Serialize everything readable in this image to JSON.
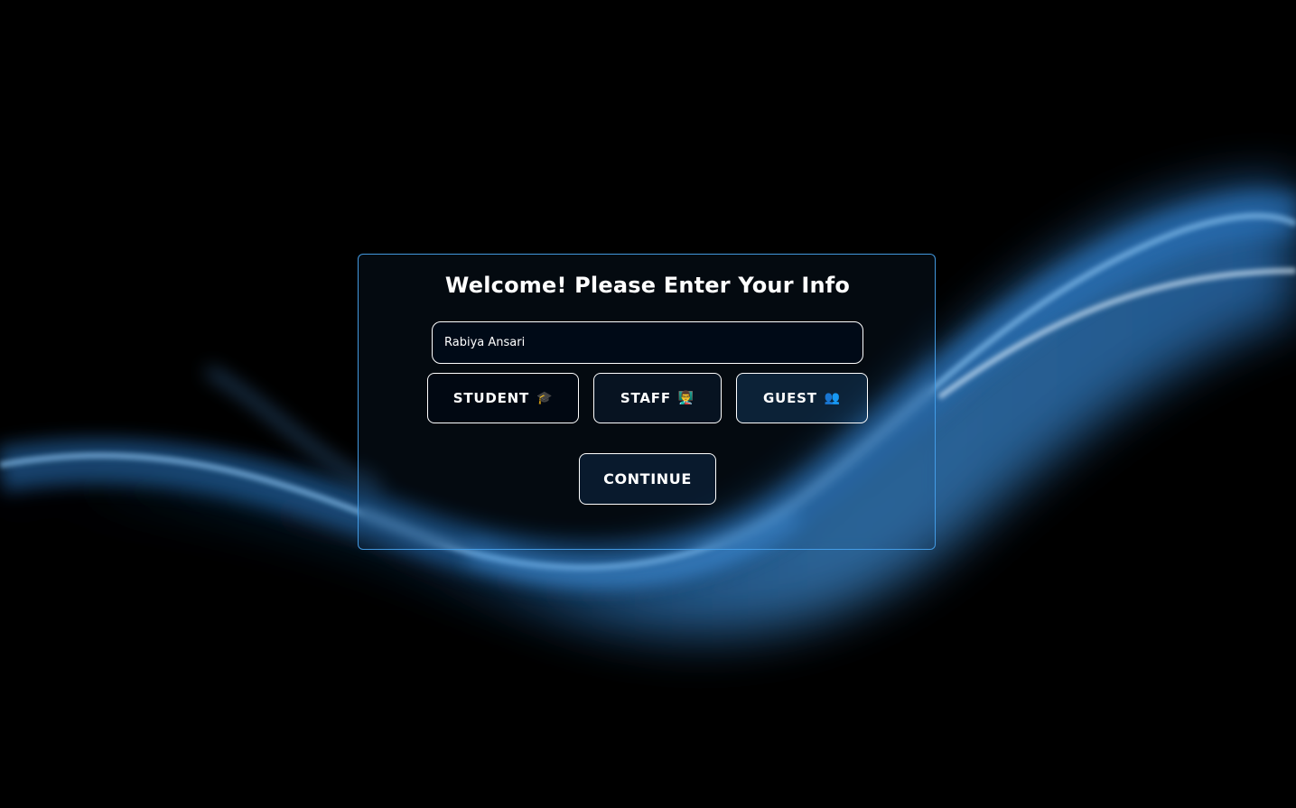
{
  "form": {
    "title": "Welcome! Please Enter Your Info",
    "name_value": "Rabiya Ansari",
    "roles": [
      {
        "label": "STUDENT",
        "emoji": "🎓"
      },
      {
        "label": "STAFF",
        "emoji": "👨‍🏫"
      },
      {
        "label": "GUEST",
        "emoji": "👥"
      }
    ],
    "continue_label": "CONTINUE"
  },
  "colors": {
    "background": "#000000",
    "wave_blue": "#3f8fd8",
    "card_border": "#46a0eb",
    "text": "#ffffff"
  }
}
